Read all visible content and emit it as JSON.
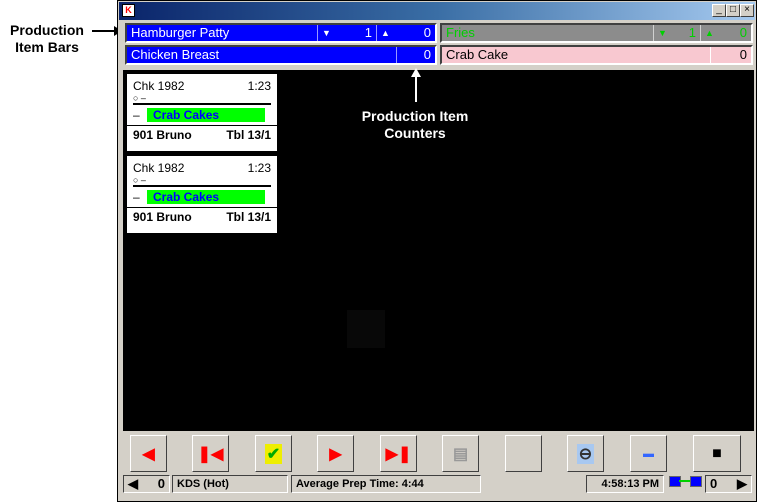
{
  "annotations": {
    "bars": "Production Item Bars",
    "counters": "Production Item Counters"
  },
  "window": {
    "controls": {
      "minimize": "_",
      "maximize": "□",
      "close": "×"
    }
  },
  "production_bars": [
    {
      "name": "Hamburger Patty",
      "down": "1",
      "up": "0",
      "bg": "#0000ff",
      "fg": "#ffffff"
    },
    {
      "name": "Fries",
      "down": "1",
      "up": "0",
      "bg": "#8c8c8c",
      "fg": "#00d000"
    },
    {
      "name": "Chicken Breast",
      "count": "0",
      "bg": "#0000ff",
      "fg": "#ffffff"
    },
    {
      "name": "Crab Cake",
      "count": "0",
      "bg": "#f8c8d0",
      "fg": "#000000"
    }
  ],
  "tickets": [
    {
      "check": "Chk 1982",
      "time": "1:23",
      "mod": "○ –",
      "dash": "–",
      "item": "Crab Cakes",
      "server": "901 Bruno",
      "table": "Tbl 13/1"
    },
    {
      "check": "Chk 1982",
      "time": "1:23",
      "mod": "○ –",
      "dash": "–",
      "item": "Crab Cakes",
      "server": "901 Bruno",
      "table": "Tbl 13/1"
    }
  ],
  "status": {
    "left_count": "0",
    "left_arrow": "◀",
    "station": "KDS (Hot)",
    "avg_prep": "Average Prep Time: 4:44",
    "clock": "4:58:13 PM",
    "right_count": "0",
    "right_arrow": "▶"
  }
}
